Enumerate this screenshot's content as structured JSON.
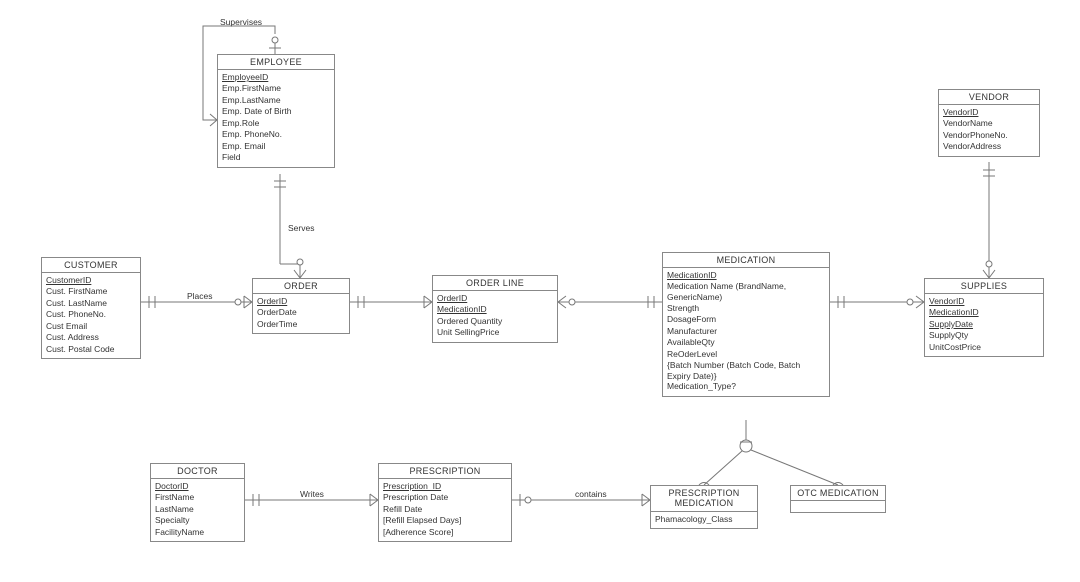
{
  "entities": {
    "employee": {
      "title": "EMPLOYEE",
      "pk": "EmployeeID",
      "attrs": [
        "Emp.FirstName",
        "Emp.LastName",
        "Emp. Date of Birth",
        "Emp.Role",
        "Emp. PhoneNo.",
        "Emp. Email",
        "Field"
      ]
    },
    "customer": {
      "title": "CUSTOMER",
      "pk": "CustomerID",
      "attrs": [
        "Cust. FirstName",
        "Cust. LastName",
        "Cust. PhoneNo.",
        "Cust Email",
        "Cust. Address",
        "Cust. Postal Code"
      ]
    },
    "order": {
      "title": "ORDER",
      "pk": "OrderID",
      "attrs": [
        "OrderDate",
        "OrderTime"
      ]
    },
    "orderline": {
      "title": "ORDER LINE",
      "pk1": "OrderID",
      "pk2": "MedicationID",
      "attrs": [
        "Ordered Quantity",
        "Unit SellingPrice"
      ]
    },
    "medication": {
      "title": "MEDICATION",
      "pk": "MedicationID",
      "attrs": [
        "Medication Name (BrandName, GenericName)",
        "Strength",
        "DosageForm",
        "Manufacturer",
        "AvailableQty",
        "ReOderLevel",
        "{Batch Number  (Batch Code, Batch Expiry Date)}",
        "Medication_Type?"
      ]
    },
    "vendor": {
      "title": "VENDOR",
      "pk": "VendorID",
      "attrs": [
        "VendorName",
        "VendorPhoneNo.",
        "VendorAddress"
      ]
    },
    "supplies": {
      "title": "SUPPLIES",
      "pk1": "VendorID",
      "pk2": "MedicationID",
      "pk3": "SupplyDate",
      "attrs": [
        "SupplyQty",
        "UnitCostPrice"
      ]
    },
    "doctor": {
      "title": "DOCTOR",
      "pk": "DoctorID",
      "attrs": [
        "FirstName",
        "LastName",
        "Specialty",
        "FacilityName"
      ]
    },
    "prescription": {
      "title": "PRESCRIPTION",
      "pk": "Prescription_ID",
      "attrs": [
        "Prescription Date",
        "Refill Date",
        "[Refill Elapsed Days]",
        "[Adherence Score]"
      ]
    },
    "prescription_med": {
      "title": "PRESCRIPTION MEDICATION",
      "attrs": [
        "Phamacology_Class"
      ]
    },
    "otc_med": {
      "title": "OTC MEDICATION"
    }
  },
  "relationships": {
    "supervises": "Supervises",
    "serves": "Serves",
    "places": "Places",
    "writes": "Writes",
    "contains": "contains"
  }
}
